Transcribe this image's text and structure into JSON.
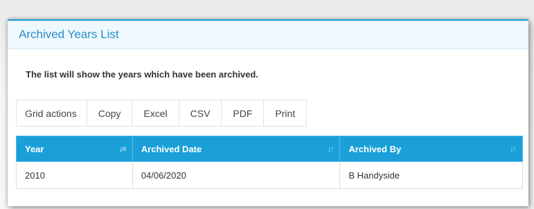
{
  "panel": {
    "title": "Archived Years List",
    "description": "The list will show the years which have been archived."
  },
  "grid_actions": {
    "label": "Grid actions",
    "buttons": [
      "Copy",
      "Excel",
      "CSV",
      "PDF",
      "Print"
    ]
  },
  "table": {
    "columns": [
      "Year",
      "Archived Date",
      "Archived By"
    ],
    "rows": [
      [
        "2010",
        "04/06/2020",
        "B Handyside"
      ]
    ],
    "sorted_column": "Year",
    "sort_direction": "ascending"
  },
  "colors": {
    "accent": "#1a9fd9",
    "title": "#2a8fc8",
    "header_bg": "#eef8fd"
  }
}
